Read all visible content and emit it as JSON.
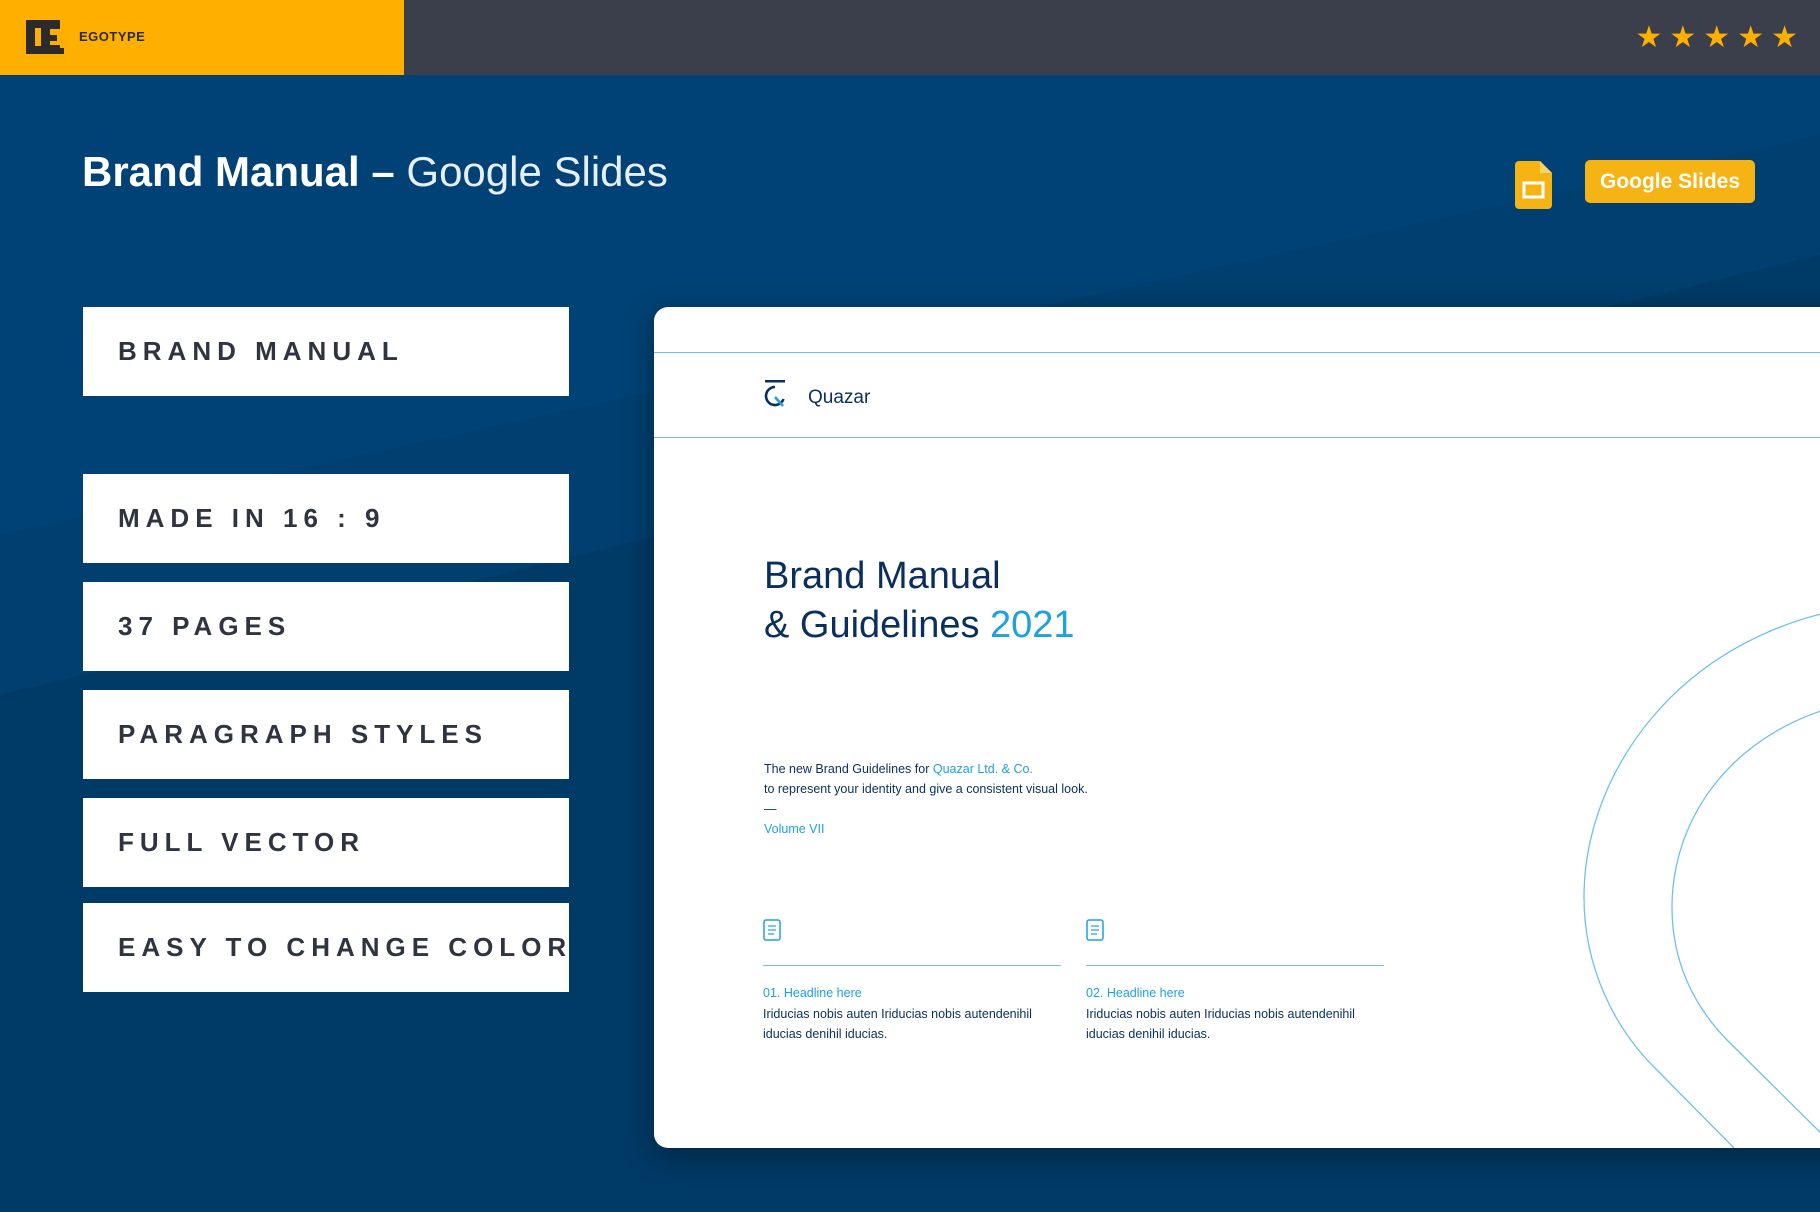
{
  "topbar": {
    "brand_name": "EGOTYPE",
    "rating_stars": 5,
    "colors": {
      "brand_block": "#ffaf00",
      "bar": "#3a3f4b",
      "star": "#ffaf00"
    }
  },
  "headline": {
    "bold": "Brand Manual –",
    "light": "Google Slides"
  },
  "google_slides_icon": "google-slides-icon",
  "platform_badge": "Google Slides",
  "features": [
    "BRAND MANUAL",
    "MADE IN 16 : 9",
    "37 PAGES",
    "PARAGRAPH STYLES",
    "FULL VECTOR",
    "EASY TO CHANGE COLOR"
  ],
  "slide": {
    "company": "Quazar",
    "title_line1": "Brand Manual",
    "title_line2": "& Guidelines",
    "title_year": "2021",
    "desc_prefix": "The new Brand Guidelines for",
    "desc_company": "Quazar Ltd. & Co.",
    "desc_line2": "to represent your identity and give a consistent visual look.",
    "dash": "—",
    "volume": "Volume VII",
    "columns": [
      {
        "heading": "01. Headline here",
        "text1": "Iriducias nobis auten Iriducias nobis autendenihil",
        "text2": "iducias denihil iducias."
      },
      {
        "heading": "02. Headline here",
        "text1": "Iriducias nobis auten Iriducias nobis autendenihil",
        "text2": "iducias denihil iducias."
      }
    ],
    "colors": {
      "navy": "#0a2f5c",
      "accent": "#1da1e2",
      "rule": "#6ec1ec"
    }
  },
  "page_colors": {
    "background": "#003f6f",
    "badge": "#f6b314"
  }
}
